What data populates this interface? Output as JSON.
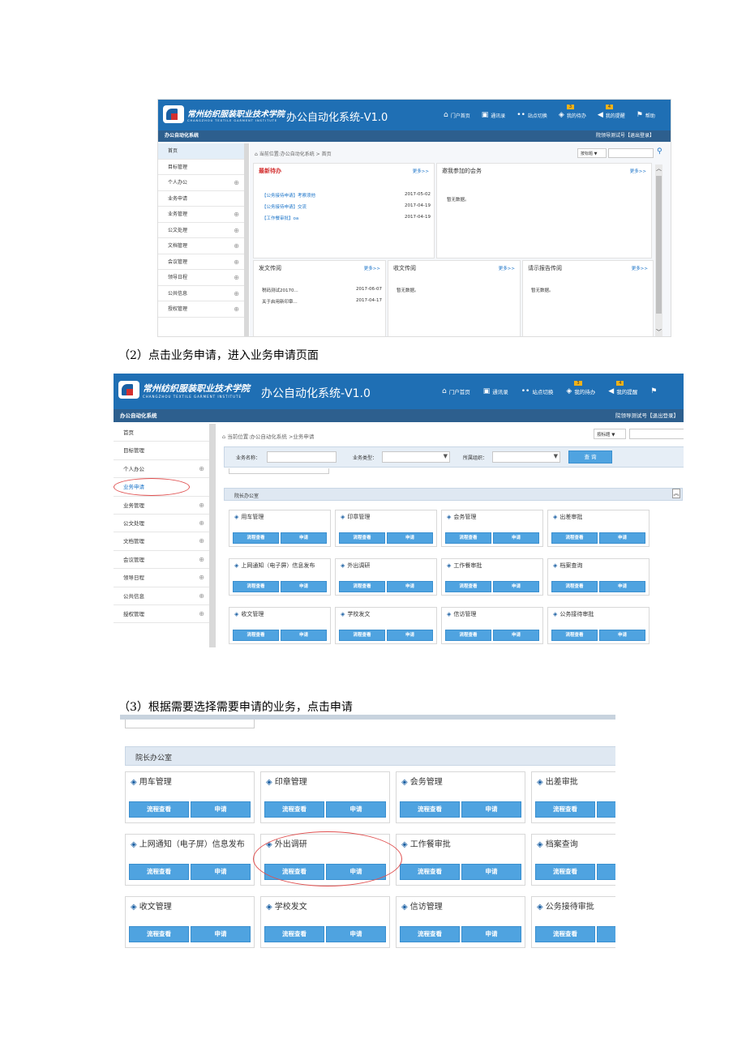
{
  "shot1": {
    "logo_cn": "常州纺织服装职业技术学院",
    "logo_en": "CHANGZHOU TEXTILE GARMENT INSTITUTE",
    "system_title": "办公自动化系统-V1.0",
    "nav": [
      {
        "label": "门户首页",
        "icon": "home-icon"
      },
      {
        "label": "通讯录",
        "icon": "contacts-icon"
      },
      {
        "label": "站点切换",
        "icon": "switch-icon"
      },
      {
        "label": "我的待办",
        "icon": "todo-icon",
        "badge": "3"
      },
      {
        "label": "我的提醒",
        "icon": "megaphone-icon",
        "badge": "4"
      },
      {
        "label": "帮助",
        "icon": "flag-icon"
      }
    ],
    "subbar_title": "办公自动化系统",
    "user_info": "院领导测试号【退出登录】",
    "sidebar": [
      "首页",
      "目标管理",
      "个人办公",
      "业务申请",
      "业务管理",
      "公文处理",
      "文档管理",
      "会议管理",
      "领导日程",
      "公共信息",
      "授权管理"
    ],
    "breadcrumb": "当前位置:办公自动化系统 > 首页",
    "search_select": "按标题",
    "panels": {
      "todo": {
        "title": "最新待办",
        "more": "更多>>",
        "rows": [
          {
            "text": "【公务接待申请】考察须他",
            "date": "2017-05-02"
          },
          {
            "text": "【公务接待申请】交流",
            "date": "2017-04-19"
          },
          {
            "text": "【工作餐审批】oa",
            "date": "2017-04-19"
          }
        ]
      },
      "meetings": {
        "title": "邀我参加的会务",
        "more": "更多>>",
        "empty": "暂无数据。"
      },
      "outgoing": {
        "title": "发文传阅",
        "more": "更多>>",
        "rows": [
          {
            "text": "税码测试20170...",
            "date": "2017-06-07"
          },
          {
            "text": "关于启用新印章...",
            "date": "2017-04-17"
          }
        ]
      },
      "incoming": {
        "title": "收文传阅",
        "more": "更多>>",
        "empty": "暂无数据。"
      },
      "reports": {
        "title": "请示报告传阅",
        "more": "更多>>",
        "empty": "暂无数据。"
      }
    }
  },
  "caption2": "（2）点击业务申请，进入业务申请页面",
  "shot2": {
    "logo_cn": "常州纺织服装职业技术学院",
    "logo_en": "CHANGZHOU TEXTILE GARMENT INSTITUTE",
    "system_title": "办公自动化系统-V1.0",
    "nav": [
      {
        "label": "门户首页",
        "icon": "home-icon"
      },
      {
        "label": "通讯录",
        "icon": "contacts-icon"
      },
      {
        "label": "站点切换",
        "icon": "switch-icon"
      },
      {
        "label": "我的待办",
        "icon": "todo-icon",
        "badge": "3"
      },
      {
        "label": "我的提醒",
        "icon": "megaphone-icon",
        "badge": "4"
      }
    ],
    "subbar_title": "办公自动化系统",
    "user_info": "院领导测试号【退出登录】",
    "sidebar": [
      "首页",
      "目标管理",
      "个人办公",
      "业务申请",
      "业务管理",
      "公文处理",
      "文档管理",
      "会议管理",
      "领导日程",
      "公共信息",
      "授权管理"
    ],
    "breadcrumb": "当前位置:办公自动化系统 >业务申请",
    "search_select": "按标题",
    "filter": {
      "name_label": "业务名称：",
      "type_label": "业务类型：",
      "org_label": "所属组织：",
      "query": "查 询"
    },
    "section": "院长办公室",
    "cards": [
      "用车管理",
      "印章管理",
      "会务管理",
      "出差审批",
      "上网通知（电子屏）信息发布",
      "外出调研",
      "工作餐审批",
      "档案查询",
      "收文管理",
      "学校发文",
      "信访管理",
      "公务接待审批"
    ],
    "btn_flow": "流程查看",
    "btn_apply": "申请"
  },
  "caption3": "（3）根据需要选择需要申请的业务，点击申请",
  "shot3": {
    "section": "院长办公室",
    "cards": [
      "用车管理",
      "印章管理",
      "会务管理",
      "出差审批",
      "上网通知（电子屏）信息发布",
      "外出调研",
      "工作餐审批",
      "档案查询",
      "收文管理",
      "学校发文",
      "信访管理",
      "公务接待审批"
    ],
    "btn_flow": "流程查看",
    "btn_apply": "申请"
  }
}
